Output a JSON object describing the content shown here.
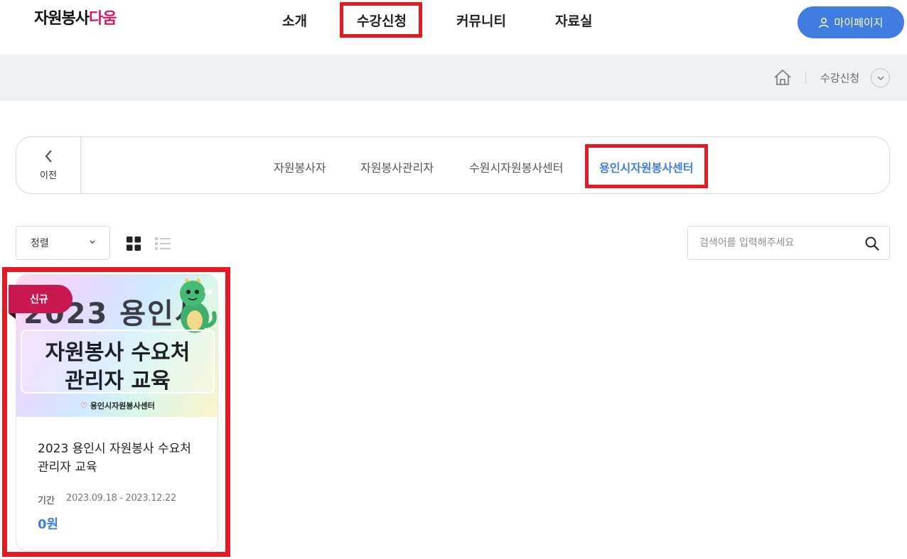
{
  "header": {
    "logo_part1": "자원봉사",
    "logo_part2": "다움",
    "nav": [
      "소개",
      "수강신청",
      "커뮤니티",
      "자료실"
    ],
    "mypage_label": "마이페이지"
  },
  "breadcrumb": {
    "current": "수강신청"
  },
  "tabs": {
    "prev_label": "이전",
    "items": [
      "자원봉사자",
      "자원봉사관리자",
      "수원시자원봉사센터",
      "용인시자원봉사센터"
    ],
    "active": "용인시자원봉사센터"
  },
  "toolbar": {
    "sort_label": "정렬",
    "search_placeholder": "검색어를 입력해주세요"
  },
  "course": {
    "badge": "신규",
    "thumb_year": "2023 용인시",
    "thumb_line1": "자원봉사 수요처",
    "thumb_line2": "관리자 교육",
    "thumb_center": "용인시자원봉사센터",
    "title": "2023 용인시 자원봉사 수요처 관리자 교육",
    "period_label": "기간",
    "period": "2023.09.18 - 2023.12.22",
    "price": "0원"
  },
  "colors": {
    "accent": "#3f7de0",
    "highlight": "#e41b23",
    "badge": "#c8184f",
    "logo_pink": "#d81b60"
  }
}
